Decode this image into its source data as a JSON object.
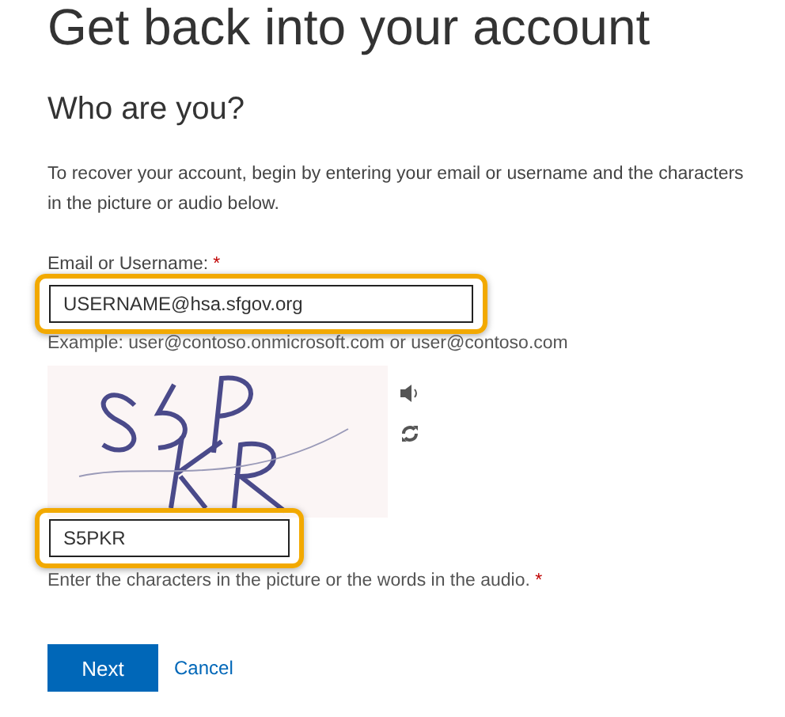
{
  "page": {
    "title": "Get back into your account"
  },
  "section": {
    "heading": "Who are you?"
  },
  "intro": "To recover your account, begin by entering your email or username and the characters in the picture or audio below.",
  "email_field": {
    "label": "Email or Username:",
    "required_mark": "*",
    "value": "USERNAME@hsa.sfgov.org",
    "example": "Example: user@contoso.onmicrosoft.com or user@contoso.com",
    "highlighted": true
  },
  "captcha_field": {
    "value": "S5PKR",
    "hint": "Enter the characters in the picture or the words in the audio.",
    "required_mark": "*",
    "highlighted": true
  },
  "buttons": [
    {
      "label": "Next",
      "kind": "primary"
    },
    {
      "label": "Cancel",
      "kind": "link"
    }
  ]
}
